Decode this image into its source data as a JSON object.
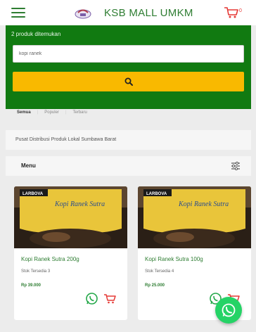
{
  "header": {
    "brand": "KSB MALL UMKM",
    "cart_badge": "0"
  },
  "search": {
    "result_text": "2 produk ditemukan",
    "query": "kopi ranek"
  },
  "tabs": [
    "Semua",
    "Populer",
    "Terbaru"
  ],
  "info": {
    "text": "Pusat Distribusi Produk Lokal Sumbawa Barat"
  },
  "menu": {
    "title": "Menu"
  },
  "products": [
    {
      "badge": "LARBOVA",
      "package_text": "Kopi Ranek Sutra",
      "name": "Kopi Ranek Sutra 200g",
      "stock": "Stok Tersedia 3",
      "price": "Rp 39.000"
    },
    {
      "badge": "LARBOVA",
      "package_text": "Kopi Ranek Sutra",
      "name": "Kopi Ranek Sutra 100g",
      "stock": "Stok Tersedia 4",
      "price": "Rp 25.000"
    }
  ],
  "colors": {
    "brand_green": "#117a11",
    "button_yellow": "#f9b900",
    "whatsapp": "#25d366",
    "cart_red": "#e53935"
  }
}
